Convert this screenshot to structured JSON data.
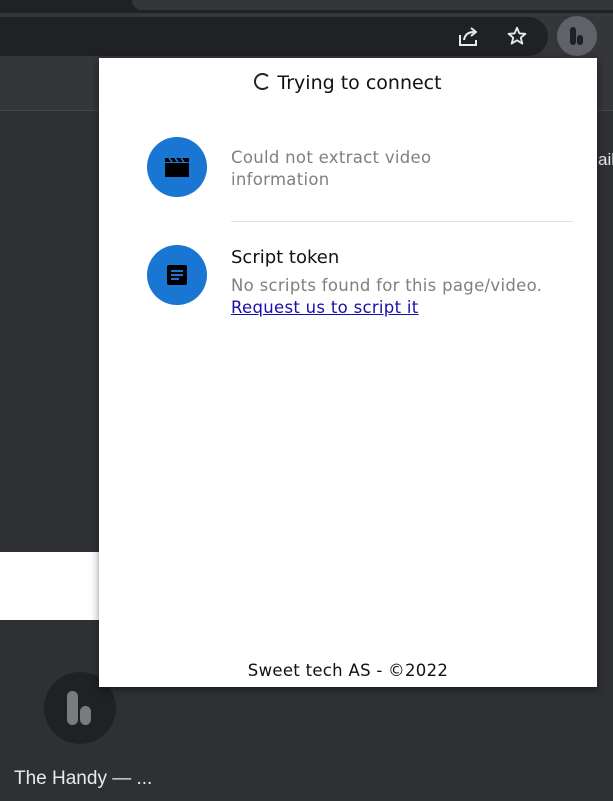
{
  "browser": {
    "icons": {
      "share": "share-icon",
      "bookmark": "star-icon",
      "extension": "handy-extension-icon"
    }
  },
  "background_page": {
    "side_text": "ail",
    "app_tile": {
      "icon": "handy-logo-icon",
      "title": "The Handy — ..."
    }
  },
  "popup": {
    "status": "Trying to connect",
    "video_row": {
      "icon": "clapperboard-icon",
      "message": "Could not extract video information"
    },
    "script_row": {
      "icon": "document-icon",
      "title": "Script token",
      "subtitle": "No scripts found for this page/video.",
      "link": "Request us to script it"
    },
    "footer": "Sweet tech AS - ©2022"
  },
  "colors": {
    "accent": "#1976d2",
    "link": "#1a0dab",
    "muted_text": "#808080",
    "browser_bg": "#35363a"
  }
}
